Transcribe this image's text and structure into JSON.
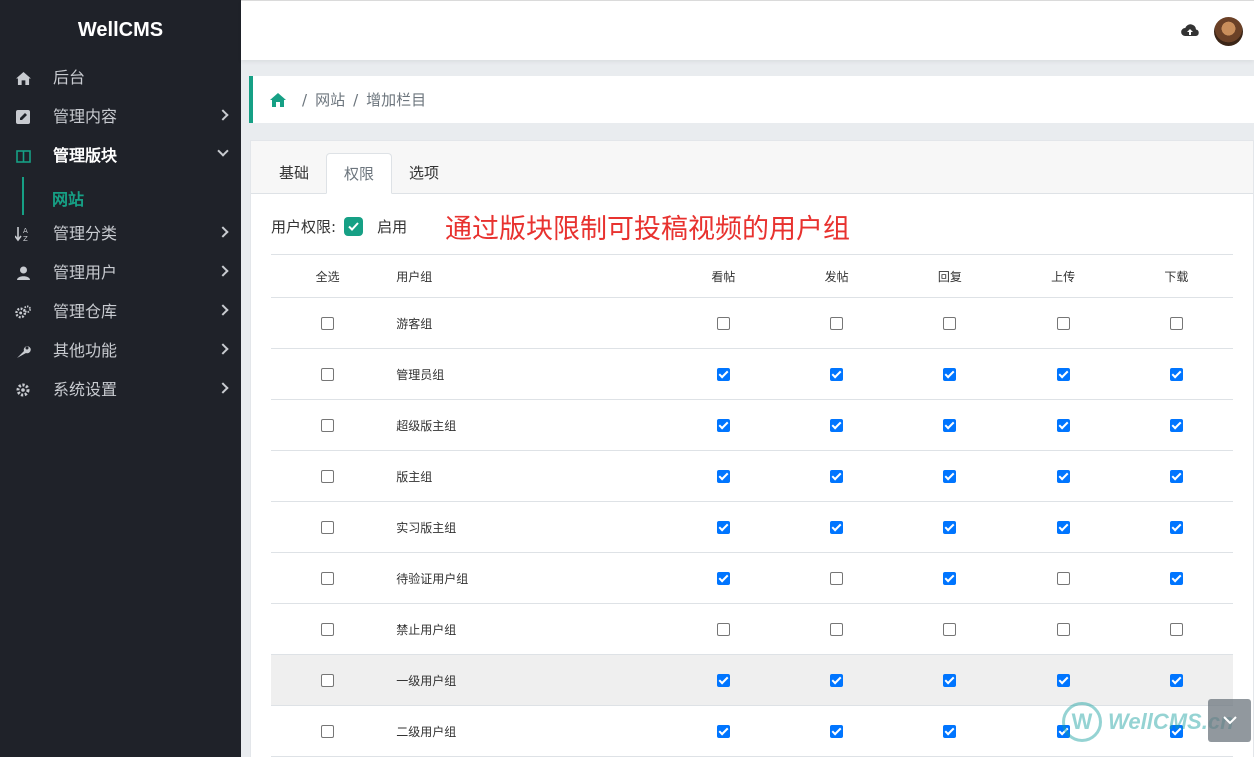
{
  "brand": "WellCMS",
  "sidebar": {
    "items": [
      {
        "label": "后台",
        "icon": "home-icon",
        "chevron": false,
        "active": false
      },
      {
        "label": "管理内容",
        "icon": "edit-icon",
        "chevron": true,
        "active": false
      },
      {
        "label": "管理版块",
        "icon": "columns-icon",
        "chevron": true,
        "active": true
      },
      {
        "label": "管理分类",
        "icon": "sort-icon",
        "chevron": true,
        "active": false
      },
      {
        "label": "管理用户",
        "icon": "user-icon",
        "chevron": true,
        "active": false
      },
      {
        "label": "管理仓库",
        "icon": "cogs-icon",
        "chevron": true,
        "active": false
      },
      {
        "label": "其他功能",
        "icon": "wrench-icon",
        "chevron": true,
        "active": false
      },
      {
        "label": "系统设置",
        "icon": "gear-icon",
        "chevron": true,
        "active": false
      }
    ],
    "sub_item": "网站"
  },
  "breadcrumb": {
    "items": [
      "网站",
      "增加栏目"
    ]
  },
  "tabs": [
    "基础",
    "权限",
    "选项"
  ],
  "permission": {
    "label": "用户权限:",
    "enable_label": "启用",
    "enabled": true
  },
  "annotation": "通过版块限制可投稿视频的用户组",
  "table": {
    "headers": [
      "全选",
      "用户组",
      "看帖",
      "发帖",
      "回复",
      "上传",
      "下载"
    ],
    "rows": [
      {
        "name": "游客组",
        "all": false,
        "perms": [
          false,
          false,
          false,
          false,
          false
        ]
      },
      {
        "name": "管理员组",
        "all": false,
        "perms": [
          true,
          true,
          true,
          true,
          true
        ]
      },
      {
        "name": "超级版主组",
        "all": false,
        "perms": [
          true,
          true,
          true,
          true,
          true
        ]
      },
      {
        "name": "版主组",
        "all": false,
        "perms": [
          true,
          true,
          true,
          true,
          true
        ]
      },
      {
        "name": "实习版主组",
        "all": false,
        "perms": [
          true,
          true,
          true,
          true,
          true
        ]
      },
      {
        "name": "待验证用户组",
        "all": false,
        "perms": [
          true,
          false,
          true,
          false,
          true
        ]
      },
      {
        "name": "禁止用户组",
        "all": false,
        "perms": [
          false,
          false,
          false,
          false,
          false
        ]
      },
      {
        "name": "一级用户组",
        "all": false,
        "perms": [
          true,
          true,
          true,
          true,
          true
        ],
        "highlight": true
      },
      {
        "name": "二级用户组",
        "all": false,
        "perms": [
          true,
          true,
          true,
          true,
          true
        ]
      }
    ]
  },
  "watermark": {
    "logo": "W",
    "text": "WellCMS.cn"
  }
}
